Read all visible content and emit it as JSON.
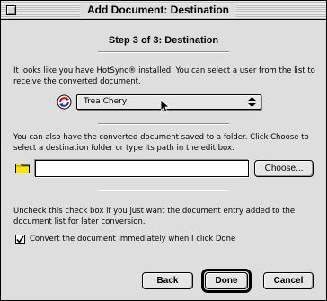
{
  "window": {
    "title": "Add Document: Destination"
  },
  "step_title": "Step 3 of 3: Destination",
  "hotsync": {
    "description": "It looks like you have HotSync® installed. You can select a user from the list to receive the converted document.",
    "icon": "hotsync-icon",
    "user_select": {
      "value": "Trea Chery"
    }
  },
  "destination": {
    "description": "You can also have the converted document saved to a folder. Click Choose to select a destination folder or type its path in the edit box.",
    "icon": "folder-icon",
    "path_value": "",
    "choose_label": "Choose..."
  },
  "convert": {
    "description": "Uncheck this check box if you just want the  document entry added to the document list for later conversion.",
    "checkbox_label": "Convert the document immediately when I click Done",
    "checked": true
  },
  "buttons": {
    "back": "Back",
    "done": "Done",
    "cancel": "Cancel"
  }
}
